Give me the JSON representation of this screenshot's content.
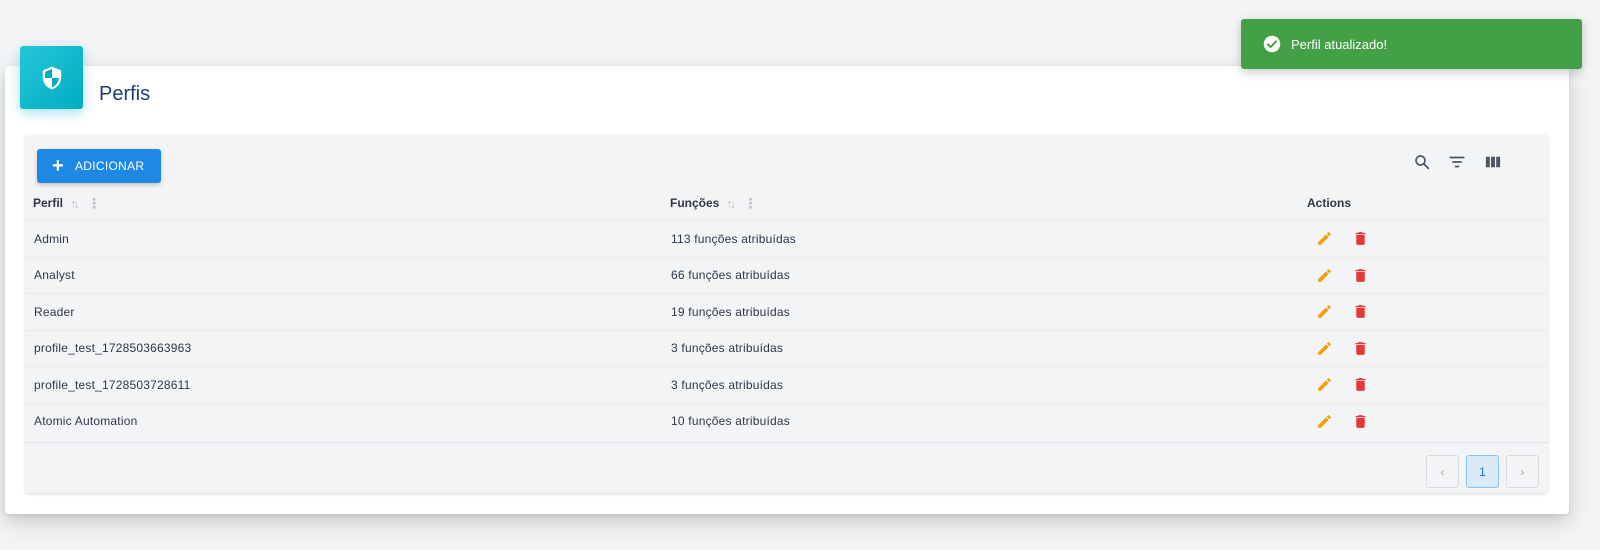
{
  "toast": {
    "message": "Perfil atualizado!",
    "icon": "check-circle-icon",
    "color": "#43a047"
  },
  "card": {
    "title": "Perfis",
    "icon": "shield-icon",
    "accent": "#00acc1"
  },
  "toolbar": {
    "add_label": "ADICIONAR",
    "add_icon": "plus-icon",
    "icons": [
      "search-icon",
      "filter-icon",
      "columns-icon"
    ]
  },
  "table": {
    "columns": {
      "profile": "Perfil",
      "functions": "Funções",
      "actions": "Actions"
    },
    "rows": [
      {
        "profile": "Admin",
        "functions": "113 funções atribuídas"
      },
      {
        "profile": "Analyst",
        "functions": "66 funções atribuídas"
      },
      {
        "profile": "Reader",
        "functions": "19 funções atribuídas"
      },
      {
        "profile": "profile_test_1728503663963",
        "functions": "3 funções atribuídas"
      },
      {
        "profile": "profile_test_1728503728611",
        "functions": "3 funções atribuídas"
      },
      {
        "profile": "Atomic Automation",
        "functions": "10 funções atribuídas"
      }
    ],
    "row_actions": {
      "edit_icon": "pencil-icon",
      "edit_color": "#f59e0b",
      "delete_icon": "trash-icon",
      "delete_color": "#e53935"
    }
  },
  "pagination": {
    "prev": "‹",
    "current": "1",
    "next": "›"
  }
}
